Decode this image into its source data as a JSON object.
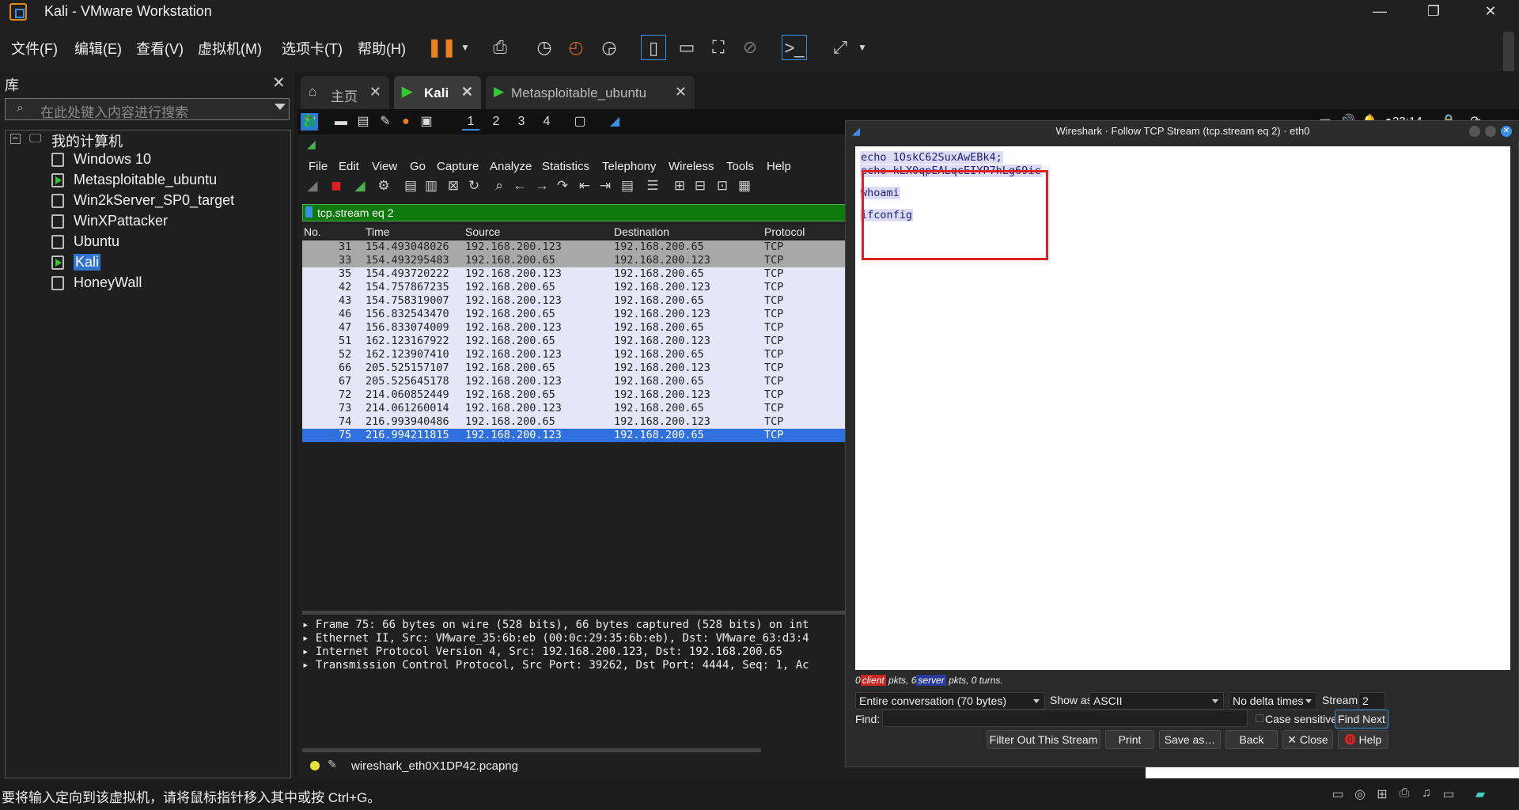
{
  "window": {
    "title": "Kali - VMware Workstation"
  },
  "menubar": {
    "items": [
      "文件(F)",
      "编辑(E)",
      "查看(V)",
      "虚拟机(M)",
      "选项卡(T)",
      "帮助(H)"
    ]
  },
  "library": {
    "title": "库",
    "search_placeholder": "在此处键入内容进行搜索",
    "root": "我的计算机",
    "vms": [
      "Windows 10",
      "Metasploitable_ubuntu",
      "Win2kServer_SP0_target",
      "WinXPattacker",
      "Ubuntu",
      "Kali",
      "HoneyWall"
    ],
    "selected": "Kali"
  },
  "tabs": [
    {
      "label": "主页"
    },
    {
      "label": "Kali"
    },
    {
      "label": "Metasploitable_ubuntu"
    }
  ],
  "kali_panel": {
    "workspaces": [
      "1",
      "2",
      "3",
      "4"
    ],
    "time": "23:14",
    "badge": "4"
  },
  "wireshark": {
    "menu": [
      "File",
      "Edit",
      "View",
      "Go",
      "Capture",
      "Analyze",
      "Statistics",
      "Telephony",
      "Wireless",
      "Tools",
      "Help"
    ],
    "filter": "tcp.stream eq 2",
    "columns": [
      "No.",
      "Time",
      "Source",
      "Destination",
      "Protocol"
    ],
    "packets": [
      [
        "31",
        "154.493048026",
        "192.168.200.123",
        "192.168.200.65",
        "TCP"
      ],
      [
        "33",
        "154.493295483",
        "192.168.200.65",
        "192.168.200.123",
        "TCP"
      ],
      [
        "35",
        "154.493720222",
        "192.168.200.123",
        "192.168.200.65",
        "TCP"
      ],
      [
        "42",
        "154.757867235",
        "192.168.200.65",
        "192.168.200.123",
        "TCP"
      ],
      [
        "43",
        "154.758319007",
        "192.168.200.123",
        "192.168.200.65",
        "TCP"
      ],
      [
        "46",
        "156.832543470",
        "192.168.200.65",
        "192.168.200.123",
        "TCP"
      ],
      [
        "47",
        "156.833074009",
        "192.168.200.123",
        "192.168.200.65",
        "TCP"
      ],
      [
        "51",
        "162.123167922",
        "192.168.200.65",
        "192.168.200.123",
        "TCP"
      ],
      [
        "52",
        "162.123907410",
        "192.168.200.123",
        "192.168.200.65",
        "TCP"
      ],
      [
        "66",
        "205.525157107",
        "192.168.200.65",
        "192.168.200.123",
        "TCP"
      ],
      [
        "67",
        "205.525645178",
        "192.168.200.123",
        "192.168.200.65",
        "TCP"
      ],
      [
        "72",
        "214.060852449",
        "192.168.200.65",
        "192.168.200.123",
        "TCP"
      ],
      [
        "73",
        "214.061260014",
        "192.168.200.123",
        "192.168.200.65",
        "TCP"
      ],
      [
        "74",
        "216.993940486",
        "192.168.200.65",
        "192.168.200.123",
        "TCP"
      ],
      [
        "75",
        "216.994211815",
        "192.168.200.123",
        "192.168.200.65",
        "TCP"
      ]
    ],
    "details": [
      "Frame 75: 66 bytes on wire (528 bits), 66 bytes captured (528 bits) on int",
      "Ethernet II, Src: VMware_35:6b:eb (00:0c:29:35:6b:eb), Dst: VMware_63:d3:4",
      "Internet Protocol Version 4, Src: 192.168.200.123, Dst: 192.168.200.65",
      "Transmission Control Protocol, Src Port: 39262, Dst Port: 4444, Seq: 1, Ac"
    ],
    "status_file": "wireshark_eth0X1DP42.pcapng"
  },
  "follow": {
    "title": "Wireshark · Follow TCP Stream (tcp.stream eq 2) · eth0",
    "lines": [
      "echo 1OskC62SuxAwEBk4;",
      "echo kLX0qpEALqcEIYP7hLg69ic",
      "whoami",
      "ifconfig"
    ],
    "turns_prefix": "0",
    "client_label": "client",
    "turns_mid": " pkts, 6",
    "server_label": "server",
    "turns_suffix": " pkts, 0 turns.",
    "conversation": "Entire conversation (70 bytes)",
    "show_as_label": "Show as",
    "show_as": "ASCII",
    "delta": "No delta times",
    "stream_label": "Stream",
    "stream_value": "2",
    "find_label": "Find:",
    "case_label": "Case sensitive",
    "buttons": {
      "find_next": "Find Next",
      "filter_out": "Filter Out This Stream",
      "print": "Print",
      "save_as": "Save as…",
      "back": "Back",
      "close": "Close",
      "help": "Help"
    }
  },
  "bottom": {
    "message": "要将输入定向到该虚拟机，请将鼠标指针移入其中或按 Ctrl+G。"
  }
}
